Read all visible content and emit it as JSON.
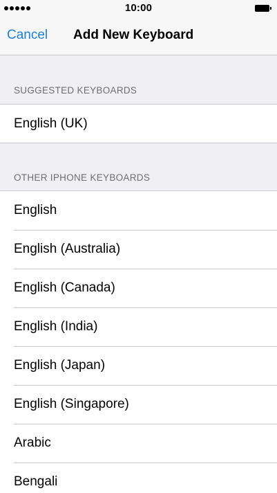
{
  "status_bar": {
    "time": "10:00",
    "signal_dots": 5,
    "battery_icon": "battery-full-icon"
  },
  "nav": {
    "cancel_label": "Cancel",
    "title": "Add New Keyboard"
  },
  "suggested": {
    "header": "SUGGESTED KEYBOARDS",
    "items": [
      {
        "label": "English (UK)"
      }
    ]
  },
  "other": {
    "header": "OTHER IPHONE KEYBOARDS",
    "items": [
      {
        "label": "English"
      },
      {
        "label": "English (Australia)"
      },
      {
        "label": "English (Canada)"
      },
      {
        "label": "English (India)"
      },
      {
        "label": "English (Japan)"
      },
      {
        "label": "English (Singapore)"
      },
      {
        "label": "Arabic"
      },
      {
        "label": "Bengali"
      }
    ]
  },
  "colors": {
    "accent": "#1a7fd4",
    "background": "#efeff4",
    "separator": "#c8c7cc",
    "header_text": "#6d6d72"
  }
}
